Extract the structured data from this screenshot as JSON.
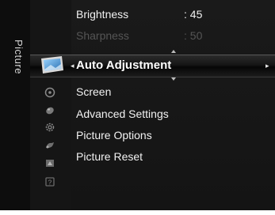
{
  "category": {
    "label": "Picture"
  },
  "items_above": [
    {
      "label": "Brightness",
      "value": ": 45"
    },
    {
      "label": "Sharpness",
      "value": ": 50"
    }
  ],
  "selected_item": {
    "label": "Auto Adjustment"
  },
  "menu_items": [
    {
      "label": "Screen"
    },
    {
      "label": "Advanced Settings"
    },
    {
      "label": "Picture Options"
    },
    {
      "label": "Picture Reset"
    }
  ],
  "icons": [
    "picture-icon",
    "sound-icon",
    "channel-icon",
    "setup-icon",
    "input-icon",
    "application-icon",
    "support-icon"
  ],
  "colors": {
    "background": "#141414",
    "text": "#f2f2f2",
    "dimmed": "#555555"
  }
}
